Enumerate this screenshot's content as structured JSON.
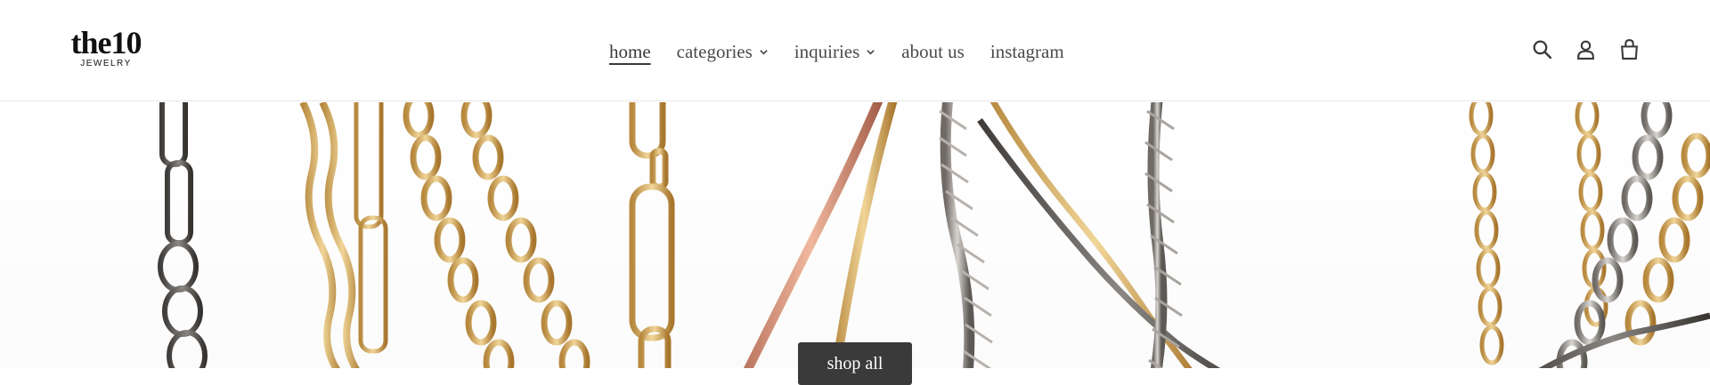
{
  "brand": {
    "logo_main": "the10",
    "logo_sub": "JEWELRY"
  },
  "nav": {
    "items": [
      {
        "label": "home",
        "active": true,
        "dropdown": false
      },
      {
        "label": "categories",
        "active": false,
        "dropdown": true
      },
      {
        "label": "inquiries",
        "active": false,
        "dropdown": true
      },
      {
        "label": "about us",
        "active": false,
        "dropdown": false
      },
      {
        "label": "instagram",
        "active": false,
        "dropdown": false
      }
    ]
  },
  "header_icons": [
    "search-icon",
    "account-icon",
    "cart-icon"
  ],
  "hero": {
    "image": "gold, rose-gold, silver and gunmetal chains hanging",
    "cta_label": "shop all"
  },
  "colors": {
    "text": "#3a3a3a",
    "button_bg": "#3a3a3a",
    "button_text": "#ffffff"
  }
}
